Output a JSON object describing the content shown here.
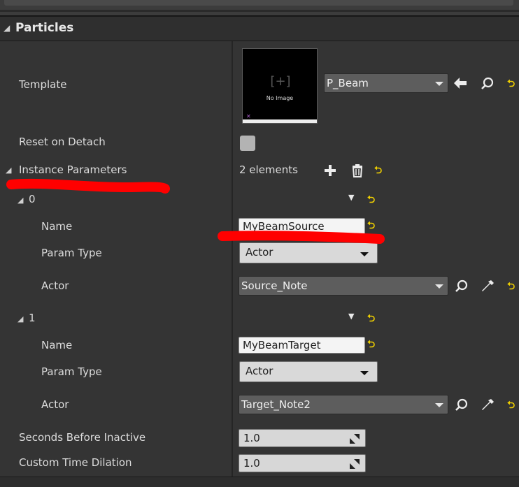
{
  "section": {
    "title": "Particles"
  },
  "template": {
    "label": "Template",
    "value": "P_Beam",
    "thumbnail_text": "No Image",
    "thumbnail_glyph": "[+]"
  },
  "reset_on_detach": {
    "label": "Reset on Detach",
    "checked": false
  },
  "instance_parameters": {
    "label": "Instance Parameters",
    "count_text": "2 elements",
    "items": [
      {
        "index": "0",
        "name_label": "Name",
        "name_value": "MyBeamSource",
        "param_type_label": "Param Type",
        "param_type_value": "Actor",
        "actor_label": "Actor",
        "actor_value": "Source_Note"
      },
      {
        "index": "1",
        "name_label": "Name",
        "name_value": "MyBeamTarget",
        "param_type_label": "Param Type",
        "param_type_value": "Actor",
        "actor_label": "Actor",
        "actor_value": "Target_Note2"
      }
    ]
  },
  "seconds_before_inactive": {
    "label": "Seconds Before Inactive",
    "value": "1.0"
  },
  "custom_time_dilation": {
    "label": "Custom Time Dilation",
    "value": "1.0"
  },
  "icons": {
    "expand": "triangle-down-left",
    "use_selected": "arrow-left-icon",
    "browse": "search-icon",
    "pick": "eyedropper-icon",
    "add": "plus-icon",
    "delete": "trash-icon",
    "reset": "reset-arrow-icon"
  },
  "colors": {
    "annotation_red": "#ff0000",
    "reset_yellow": "#f0d000",
    "panel_bg": "#343434"
  }
}
